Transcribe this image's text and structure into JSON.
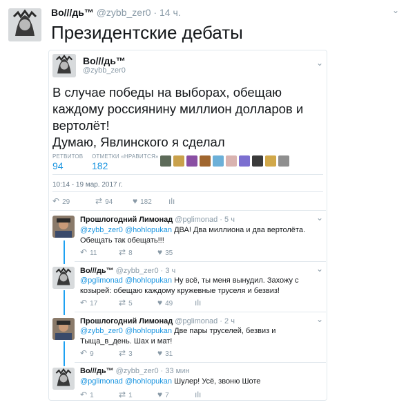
{
  "outer_tweet": {
    "name": "Во///дь™",
    "handle": "@zybb_zer0",
    "time": "14 ч.",
    "text": "Президентские дебаты"
  },
  "main_tweet": {
    "name": "Во///дь™",
    "handle": "@zybb_zer0",
    "text_lines": [
      "В случае победы на выборах, обещаю",
      "каждому россиянину миллион долларов и",
      "вертолёт!",
      "Думаю, Явлинского я сделал"
    ],
    "retweets_label": "РЕТВИТОВ",
    "retweets": "94",
    "likes_label": "ОТМЕТКИ «НРАВИТСЯ»",
    "likes": "182",
    "liker_colors": [
      "#5d6b59",
      "#c9a14b",
      "#8a4fa3",
      "#a0662f",
      "#6cb0d8",
      "#d9b3b0",
      "#7c6fd0",
      "#3b3b3b",
      "#d1a84a",
      "#8f8f8f"
    ],
    "date": "10:14 - 19 мар. 2017 г.",
    "actions": {
      "replies": "29",
      "retweets": "94",
      "likes": "182"
    }
  },
  "replies": [
    {
      "name": "Прошлогодний Лимонад",
      "handle": "@pglimonad",
      "time": "5 ч",
      "mentions": "@zybb_zer0 @hohlopukan",
      "text": " ДВА! Два миллиона и два вертолёта. Обещать так обещать!!!",
      "replies": "11",
      "retweets": "8",
      "likes": "35"
    },
    {
      "name": "Во///дь™",
      "handle": "@zybb_zer0",
      "time": "3 ч",
      "mentions": "@pglimonad @hohlopukan",
      "text": " Ну всё, ты меня вынудил. Захожу с козырей: обещаю каждому кружевные труселя и безвиз!",
      "replies": "17",
      "retweets": "5",
      "likes": "49"
    },
    {
      "name": "Прошлогодний Лимонад",
      "handle": "@pglimonad",
      "time": "2 ч",
      "mentions": "@zybb_zer0 @hohlopukan",
      "text": " Две пары труселей, безвиз и Тыща_в_день. Шах и мат!",
      "replies": "9",
      "retweets": "3",
      "likes": "31"
    },
    {
      "name": "Во///дь™",
      "handle": "@zybb_zer0",
      "time": "33 мин",
      "mentions": "@pglimonad @hohlopukan",
      "text": " Шулер! Усё, звоню Шоте",
      "replies": "1",
      "retweets": "1",
      "likes": "7"
    }
  ],
  "icons": {
    "dot": "·",
    "chevron": "⌄",
    "reply": "↶",
    "retweet": "⇄",
    "like": "♥",
    "analytics": "ılı"
  }
}
